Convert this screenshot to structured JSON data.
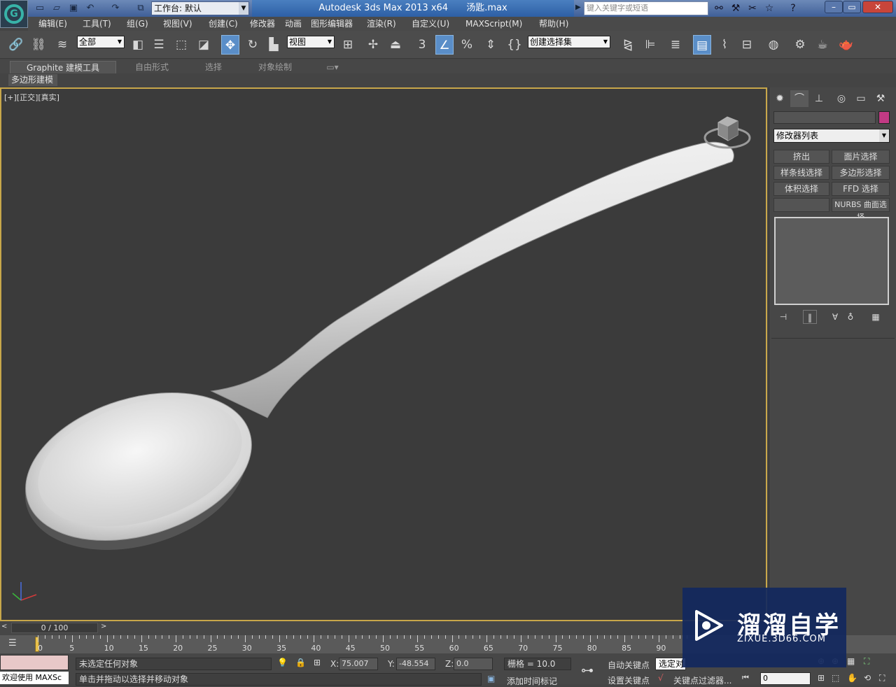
{
  "titlebar": {
    "workspace_label": "工作台: 默认",
    "app_title": "Autodesk 3ds Max  2013 x64",
    "file_name": "汤匙.max",
    "search_placeholder": "键入关键字或短语"
  },
  "menu": [
    "编辑(E)",
    "工具(T)",
    "组(G)",
    "视图(V)",
    "创建(C)",
    "修改器",
    "动画",
    "图形编辑器",
    "渲染(R)",
    "自定义(U)",
    "MAXScript(M)",
    "帮助(H)"
  ],
  "toolbar": {
    "selection_filter": "全部",
    "ref_coord": "视图",
    "named_selection": "创建选择集",
    "snap_label": "3"
  },
  "ribbon": {
    "tabs": [
      "Graphite 建模工具",
      "自由形式",
      "选择",
      "对象绘制"
    ],
    "subtab": "多边形建模"
  },
  "viewport": {
    "label": "[+][正交][真实]"
  },
  "command_panel": {
    "modifier_list": "修改器列表",
    "buttons": [
      "挤出",
      "面片选择",
      "样条线选择",
      "多边形选择",
      "体积选择",
      "FFD 选择",
      "",
      "NURBS 曲面选择"
    ],
    "object_color": "#c23a84"
  },
  "timeline": {
    "slider": "0 / 100",
    "ticks": [
      "0",
      "5",
      "10",
      "15",
      "20",
      "25",
      "30",
      "35",
      "40",
      "45",
      "50",
      "55",
      "60",
      "65",
      "70",
      "75",
      "80",
      "85",
      "90"
    ]
  },
  "status": {
    "listener": "欢迎使用 MAXSc",
    "selection_status": "未选定任何对象",
    "prompt": "单击并拖动以选择并移动对象",
    "x_label": "X:",
    "x_value": "75.007",
    "y_label": "Y:",
    "y_value": "-48.554",
    "z_label": "Z:",
    "z_value": "0.0",
    "grid": "栅格 = 10.0",
    "add_time_tag": "添加时间标记",
    "auto_key": "自动关键点",
    "set_key": "设置关键点",
    "key_mode": "选定对",
    "key_filters": "关键点过滤器...",
    "frame_field": "0"
  },
  "watermark": {
    "title": "溜溜自学",
    "url": "ZIXUE.3D66.COM"
  }
}
